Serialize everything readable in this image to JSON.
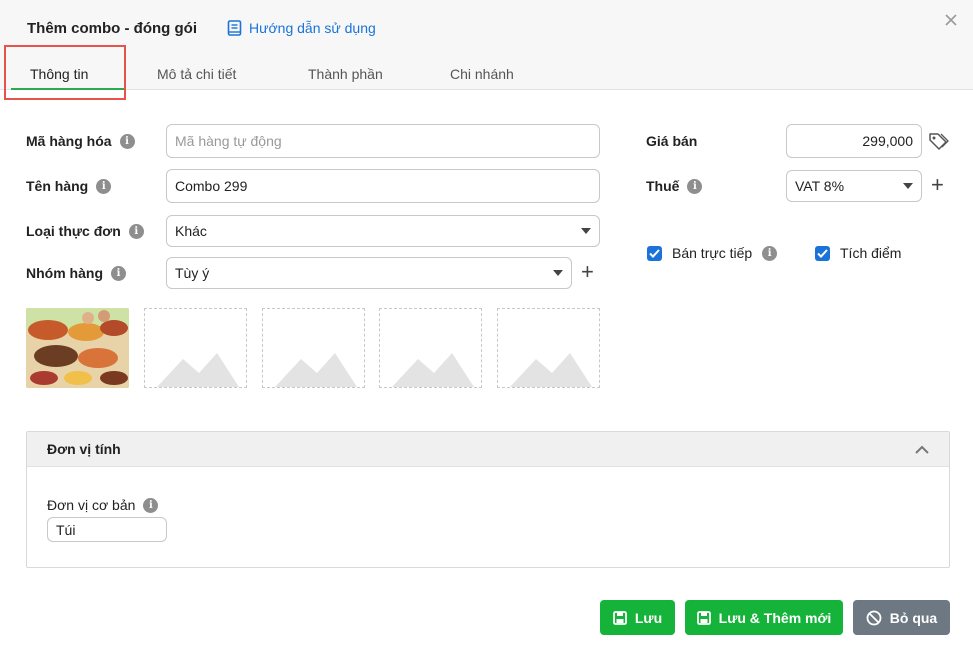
{
  "dialog": {
    "title": "Thêm combo - đóng gói",
    "guide_link": "Hướng dẫn sử dụng"
  },
  "tabs": [
    {
      "label": "Thông tin",
      "active": true
    },
    {
      "label": "Mô tả chi tiết",
      "active": false
    },
    {
      "label": "Thành phần",
      "active": false
    },
    {
      "label": "Chi nhánh",
      "active": false
    }
  ],
  "form": {
    "code": {
      "label": "Mã hàng hóa",
      "value": "",
      "placeholder": "Mã hàng tự động"
    },
    "name": {
      "label": "Tên hàng",
      "value": "Combo 299"
    },
    "menu_type": {
      "label": "Loại thực đơn",
      "value": "Khác"
    },
    "group": {
      "label": "Nhóm hàng",
      "value": "Tùy ý"
    },
    "price": {
      "label": "Giá bán",
      "value": "299,000"
    },
    "tax": {
      "label": "Thuế",
      "value": "VAT 8%"
    },
    "direct_sale": {
      "label": "Bán trực tiếp",
      "checked": true
    },
    "points": {
      "label": "Tích điểm",
      "checked": true
    }
  },
  "images": {
    "count_slots": 5,
    "filled": 1
  },
  "unit_panel": {
    "title": "Đơn vị tính",
    "base_unit_label": "Đơn vị cơ bản",
    "base_unit_value": "Túi"
  },
  "buttons": {
    "save": "Lưu",
    "save_new": "Lưu & Thêm mới",
    "skip": "Bỏ qua"
  },
  "colors": {
    "accent_green": "#16b33a",
    "link_blue": "#1a73d8",
    "tab_underline": "#2daa4a",
    "highlight_red": "#e9524a",
    "skip_gray": "#6d7883"
  }
}
